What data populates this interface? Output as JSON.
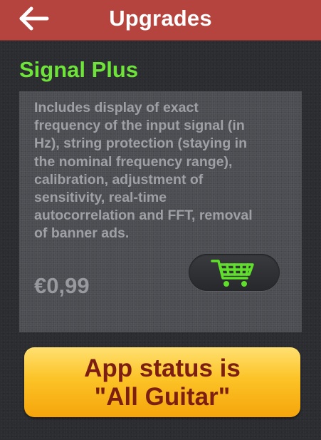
{
  "header": {
    "title": "Upgrades",
    "back_icon": "arrow-left-icon"
  },
  "upgrade": {
    "title": "Signal Plus",
    "title_color": "#6ee43a",
    "description_lines": [
      "Includes display of exact",
      "frequency of the input signal (in",
      "Hz), string protection (staying in",
      "the nominal frequency range),",
      "calibration, adjustment of",
      "sensitivity, real-time",
      "autocorrelation and FFT, removal",
      "of banner ads."
    ],
    "price": "€0,99",
    "cart_icon": "shopping-cart-icon",
    "cart_icon_color": "#5fe02a"
  },
  "status_button": {
    "line1": "App status is",
    "line2": "\"All Guitar\"",
    "text_color": "#7c1e12"
  },
  "colors": {
    "header_bg": "#b5443e",
    "page_bg": "#2c2d31",
    "card_bg": "#4c4d52",
    "button_bg": "#fcc327"
  }
}
